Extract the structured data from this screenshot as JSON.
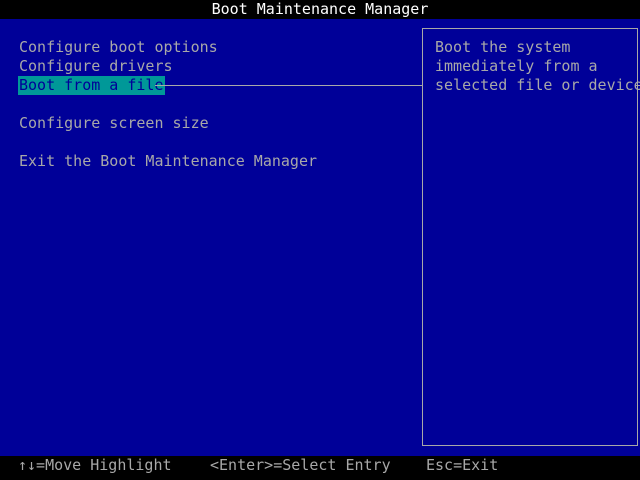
{
  "title": "Boot Maintenance Manager",
  "menu": {
    "items": [
      {
        "label": "Configure boot options",
        "selected": false
      },
      {
        "label": "Configure drivers",
        "selected": false
      },
      {
        "label": "Boot from a file",
        "selected": true
      },
      {
        "label": "Configure screen size",
        "selected": false
      },
      {
        "label": "Exit the Boot Maintenance Manager",
        "selected": false
      }
    ]
  },
  "help": {
    "lines": [
      "Boot the system",
      "immediately from a",
      "selected file or device"
    ]
  },
  "status": {
    "move": "↑↓=Move Highlight",
    "enter": "<Enter>=Select Entry",
    "exit": "Esc=Exit"
  },
  "colors": {
    "background": "#000098",
    "text": "#a8a8a8",
    "highlight": "#009898",
    "title_text": "#ffffff",
    "bars": "#000000"
  }
}
